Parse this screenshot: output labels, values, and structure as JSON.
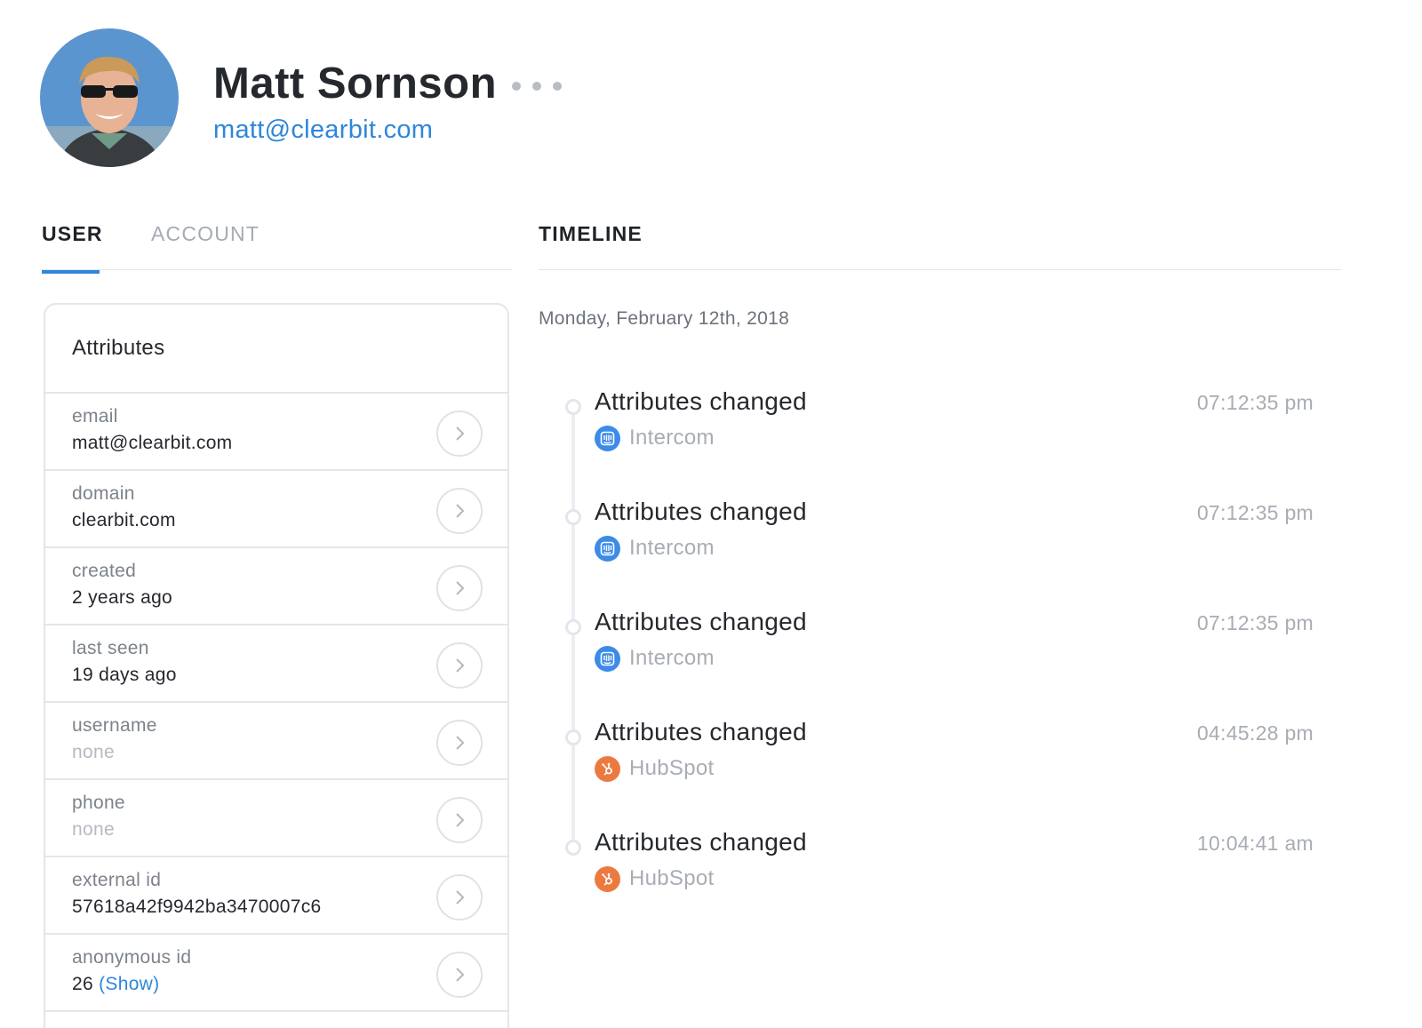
{
  "profile": {
    "name": "Matt Sornson",
    "email": "matt@clearbit.com"
  },
  "tabs": {
    "user": "USER",
    "account": "ACCOUNT",
    "active": "user"
  },
  "timeline": {
    "heading": "TIMELINE",
    "date": "Monday, February 12th, 2018",
    "events": [
      {
        "title": "Attributes changed",
        "source": "Intercom",
        "source_icon": "intercom-icon",
        "time": "07:12:35 pm"
      },
      {
        "title": "Attributes changed",
        "source": "Intercom",
        "source_icon": "intercom-icon",
        "time": "07:12:35 pm"
      },
      {
        "title": "Attributes changed",
        "source": "Intercom",
        "source_icon": "intercom-icon",
        "time": "07:12:35 pm"
      },
      {
        "title": "Attributes changed",
        "source": "HubSpot",
        "source_icon": "hubspot-icon",
        "time": "04:45:28 pm"
      },
      {
        "title": "Attributes changed",
        "source": "HubSpot",
        "source_icon": "hubspot-icon",
        "time": "10:04:41 am"
      }
    ]
  },
  "attributes": {
    "title": "Attributes",
    "rows": [
      {
        "label": "email",
        "value": "matt@clearbit.com"
      },
      {
        "label": "domain",
        "value": "clearbit.com"
      },
      {
        "label": "created",
        "value": "2 years ago"
      },
      {
        "label": "last seen",
        "value": "19 days ago"
      },
      {
        "label": "username",
        "value": "none"
      },
      {
        "label": "phone",
        "value": "none"
      },
      {
        "label": "external id",
        "value": "57618a42f9942ba3470007c6"
      },
      {
        "label": "anonymous id",
        "value": "26",
        "link": "(Show)"
      }
    ]
  },
  "colors": {
    "accent": "#2f86da",
    "intercom": "#3d8be8",
    "hubspot": "#ec7a40",
    "border": "#e3e6ea"
  }
}
